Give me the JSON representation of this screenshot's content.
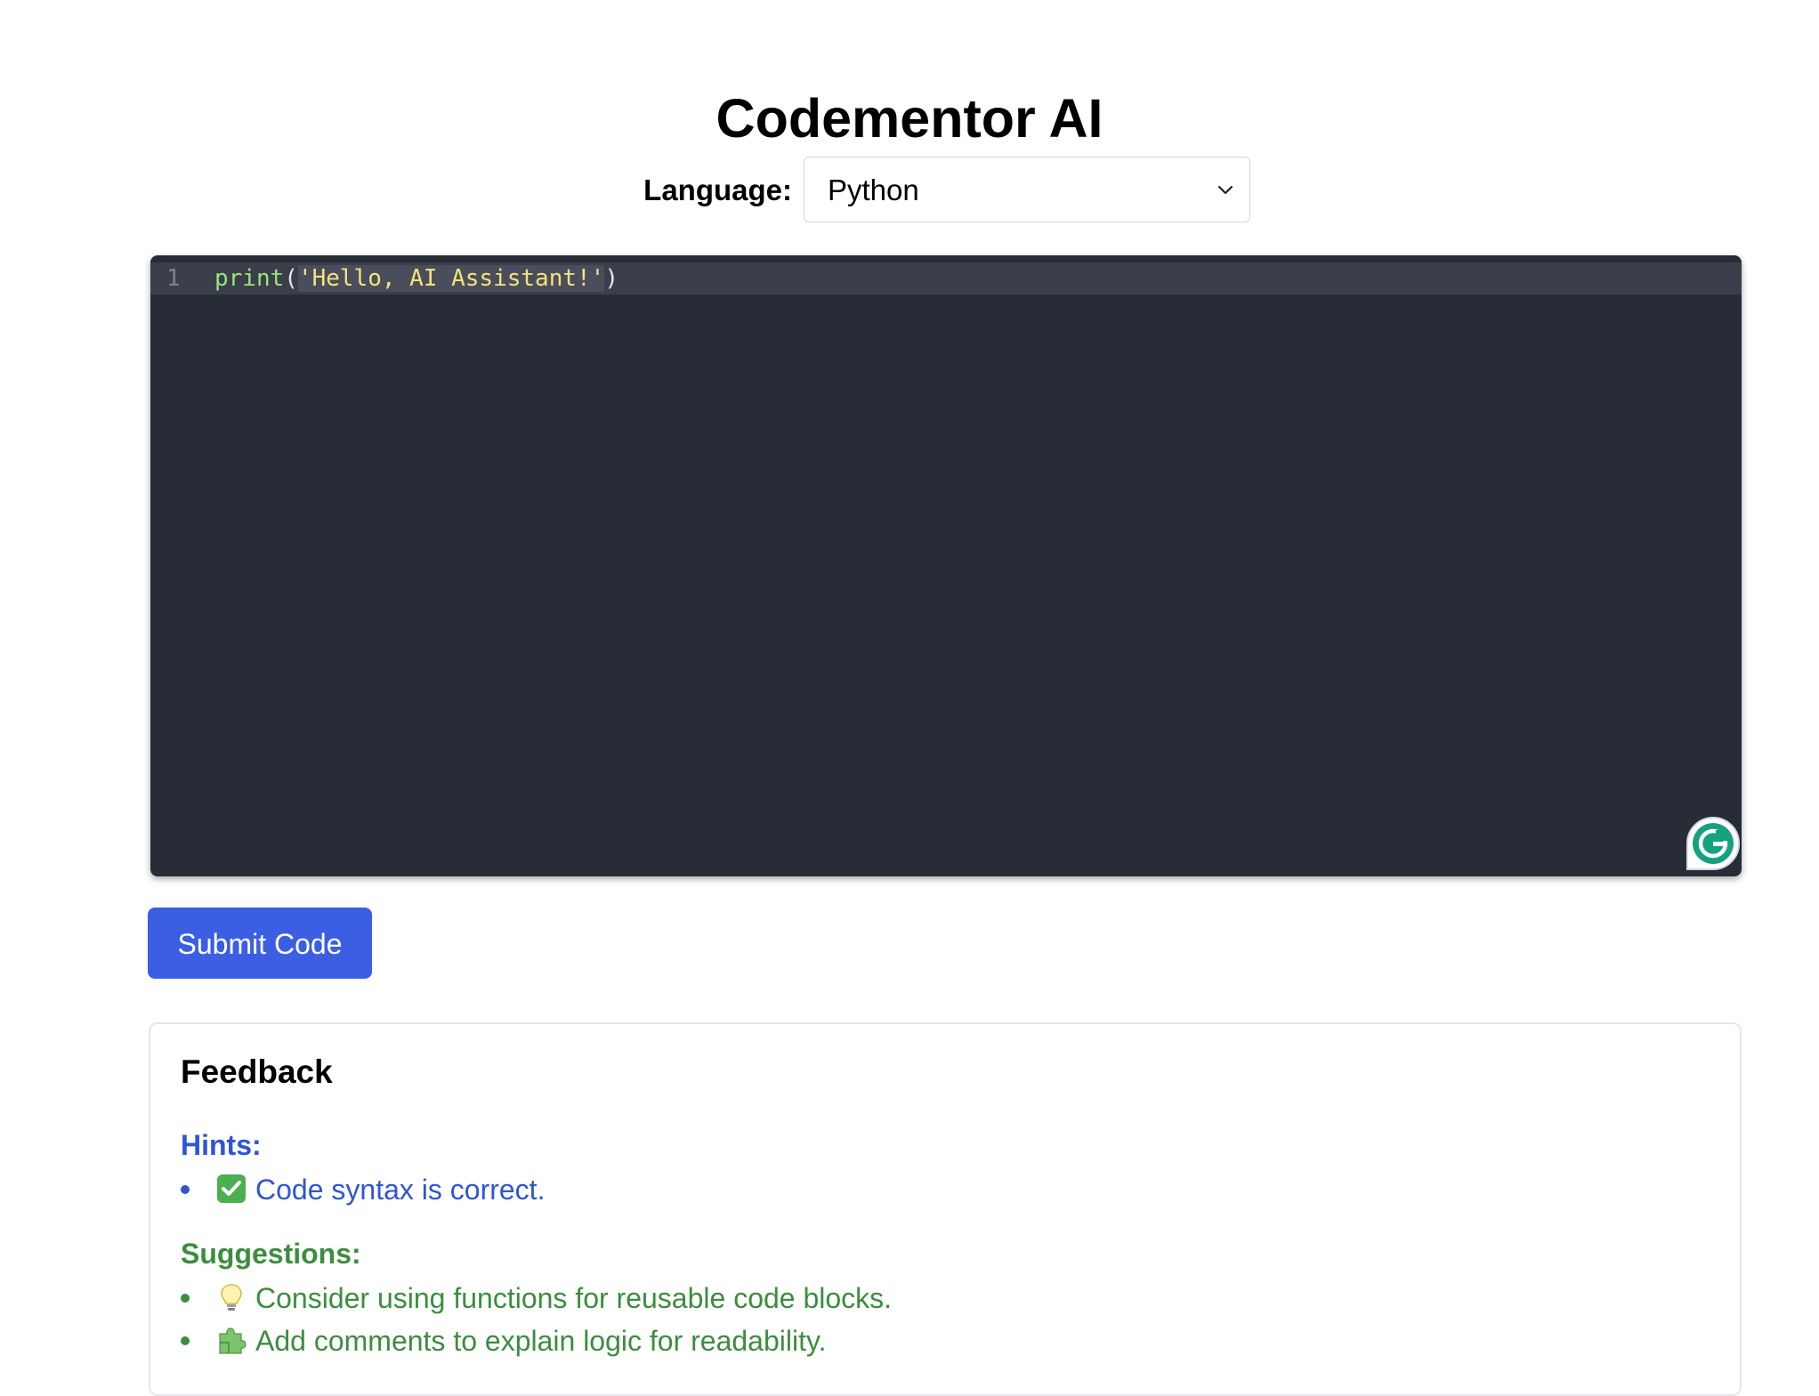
{
  "app": {
    "title": "Codementor AI"
  },
  "language": {
    "label": "Language:",
    "selected": "Python"
  },
  "editor": {
    "line_numbers": [
      "1"
    ],
    "code": {
      "fn": "print",
      "open_paren": "(",
      "string": "'Hello, AI Assistant!'",
      "close_paren": ")"
    }
  },
  "actions": {
    "submit_label": "Submit Code"
  },
  "feedback": {
    "title": "Feedback",
    "hints_title": "Hints:",
    "hints": [
      {
        "icon": "check-mark-icon",
        "text": "Code syntax is correct."
      }
    ],
    "suggestions_title": "Suggestions:",
    "suggestions": [
      {
        "icon": "lightbulb-icon",
        "text": "Consider using functions for reusable code blocks."
      },
      {
        "icon": "puzzle-piece-icon",
        "text": "Add comments to explain logic for readability."
      }
    ]
  },
  "colors": {
    "primary_button": "#3b5ee3",
    "editor_background": "#282c37",
    "hint_text": "#2f55d4",
    "suggestion_text": "#3c8d3f"
  }
}
